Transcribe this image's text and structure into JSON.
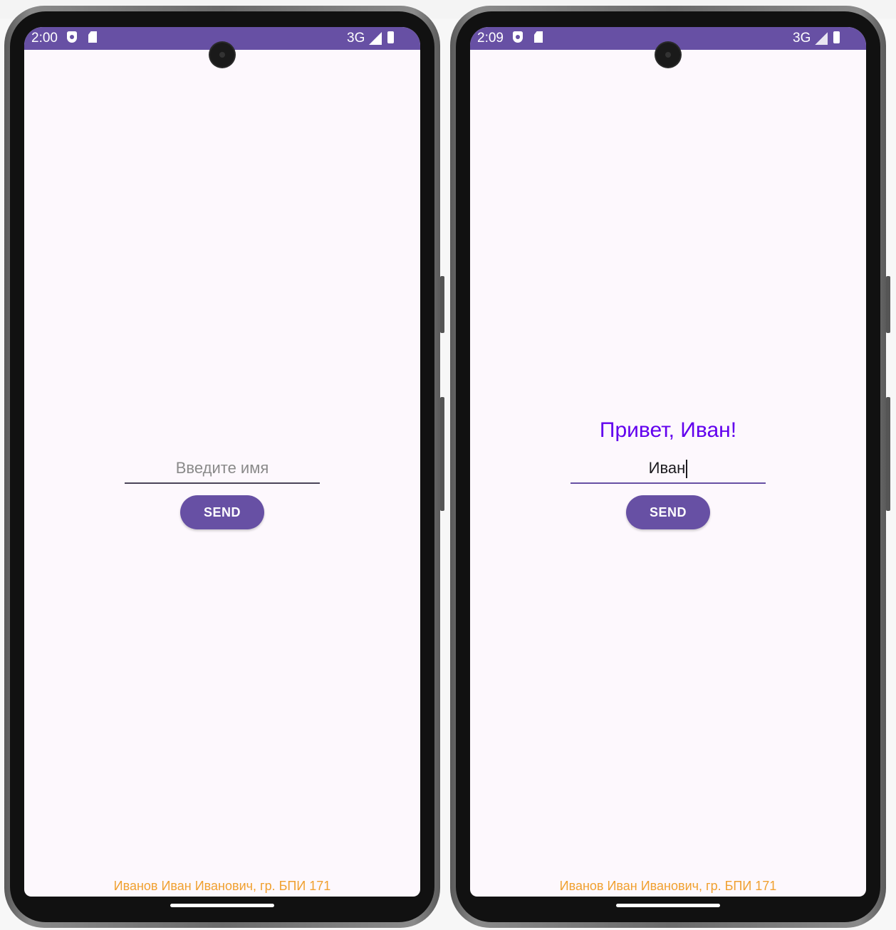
{
  "screens": [
    {
      "status": {
        "time": "2:00",
        "network": "3G"
      },
      "greeting": "",
      "field": {
        "value": "",
        "placeholder": "Введите имя"
      },
      "send_label": "SEND",
      "footer": "Иванов Иван Иванович, гр. БПИ 171"
    },
    {
      "status": {
        "time": "2:09",
        "network": "3G"
      },
      "greeting": "Привет, Иван!",
      "field": {
        "value": "Иван",
        "placeholder": ""
      },
      "send_label": "SEND",
      "footer": "Иванов Иван Иванович, гр. БПИ 171"
    }
  ],
  "colors": {
    "accent": "#6750a4",
    "greeting": "#6200ee",
    "footer": "#f0a030",
    "screen_bg": "#fdf8fd"
  },
  "icons": [
    "shield-icon",
    "sd-card-icon",
    "signal-icon",
    "battery-icon"
  ]
}
